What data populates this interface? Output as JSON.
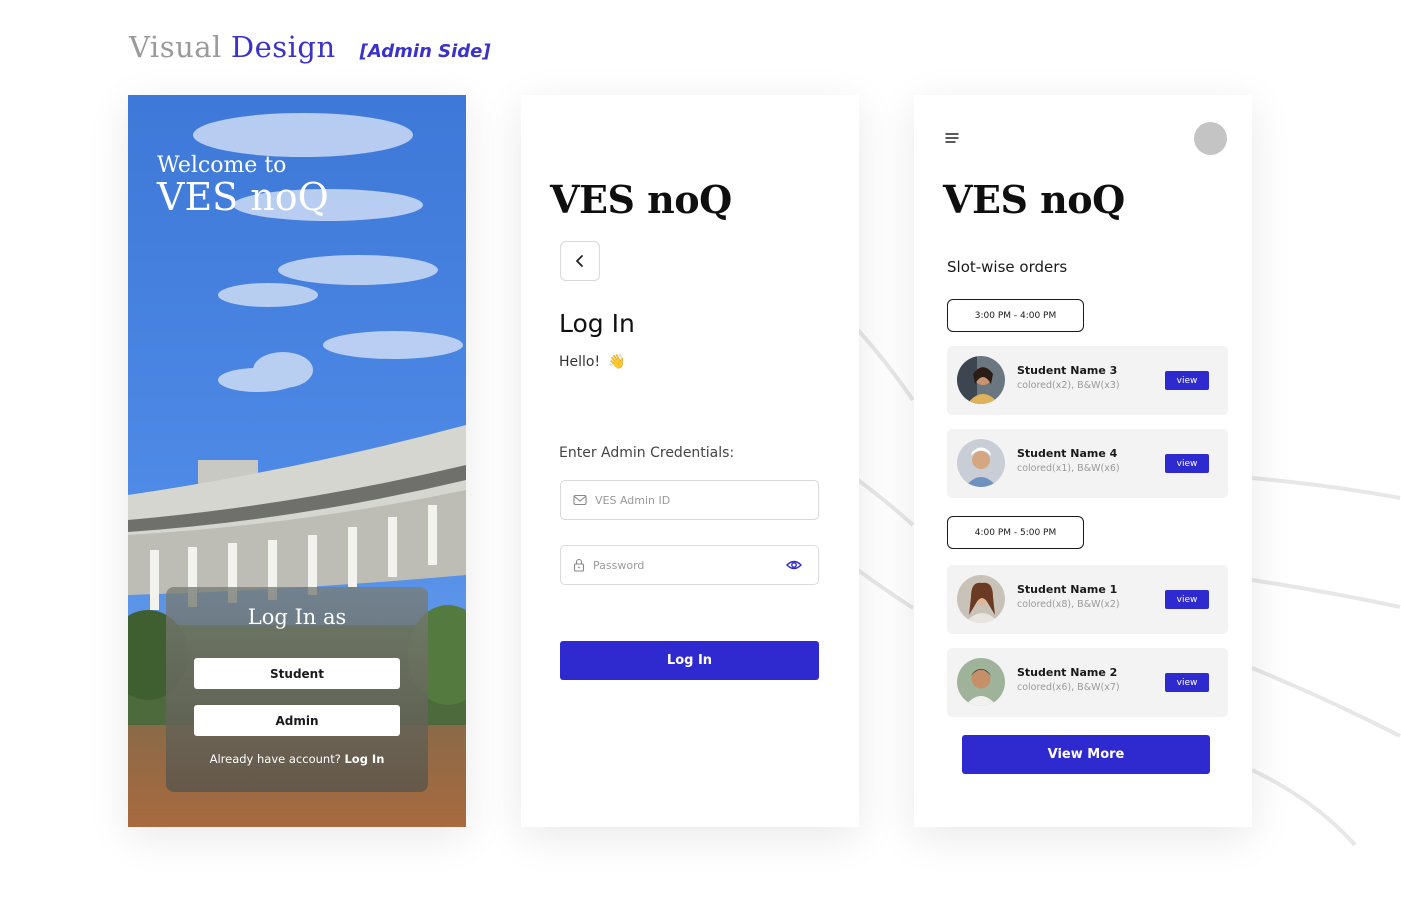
{
  "heading": {
    "word1": "Visual",
    "word2": "Design",
    "tag": "[Admin Side]"
  },
  "welcome_screen": {
    "welcome_line": "Welcome to",
    "brand": "VES noQ",
    "card_title": "Log In as",
    "student_button": "Student",
    "admin_button": "Admin",
    "footer_text": "Already have account?",
    "footer_link": "Log In"
  },
  "login_screen": {
    "brand": "VES noQ",
    "title": "Log In",
    "greeting": "Hello!",
    "greeting_icon": "waving-hand-icon",
    "credentials_label": "Enter Admin Credentials:",
    "admin_id_placeholder": "VES Admin ID",
    "password_placeholder": "Password",
    "submit_label": "Log In",
    "icons": [
      "chevron-left-icon",
      "mail-icon",
      "lock-icon",
      "eye-icon"
    ]
  },
  "orders_screen": {
    "brand": "VES noQ",
    "section_title": "Slot-wise orders",
    "slots": [
      {
        "time": "3:00 PM - 4:00 PM",
        "orders": [
          {
            "name": "Student Name 3",
            "detail": "colored(x2), B&W(x3)",
            "action": "view"
          },
          {
            "name": "Student Name 4",
            "detail": "colored(x1), B&W(x6)",
            "action": "view"
          }
        ]
      },
      {
        "time": "4:00 PM - 5:00 PM",
        "orders": [
          {
            "name": "Student Name 1",
            "detail": "colored(x8), B&W(x2)",
            "action": "view"
          },
          {
            "name": "Student Name 2",
            "detail": "colored(x6), B&W(x7)",
            "action": "view"
          }
        ]
      }
    ],
    "view_more_label": "View More"
  },
  "colors": {
    "accent": "#2f2ad0",
    "heading_grey": "#9a9a9a",
    "card_bg": "#f3f3f3",
    "sky": "#3f79d8"
  }
}
